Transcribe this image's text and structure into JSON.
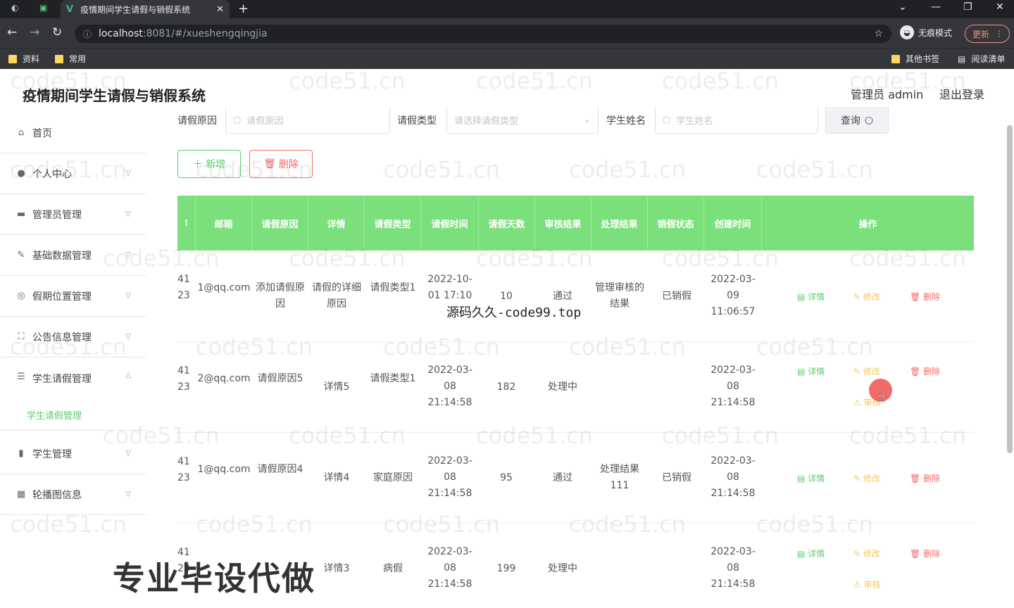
{
  "browser": {
    "tab_title": "疫情期间学生请假与销假系统",
    "tab_logo": "V",
    "url_host": "localhost",
    "url_path": ":8081/#/xueshengqingjia",
    "incognito_label": "无痕模式",
    "update_label": "更新",
    "bookmarks": [
      "资料",
      "常用"
    ],
    "bookmarks_right": [
      "其他书签",
      "阅读清单"
    ]
  },
  "app": {
    "title": "疫情期间学生请假与销假系统",
    "admin_label": "管理员 admin",
    "logout_label": "退出登录"
  },
  "sidebar": {
    "items": [
      {
        "label": "首页",
        "icon": "home-icon"
      },
      {
        "label": "个人中心",
        "icon": "user-icon"
      },
      {
        "label": "管理员管理",
        "icon": "admin-icon"
      },
      {
        "label": "基础数据管理",
        "icon": "data-icon"
      },
      {
        "label": "假期位置管理",
        "icon": "location-icon"
      },
      {
        "label": "公告信息管理",
        "icon": "notice-icon"
      },
      {
        "label": "学生请假管理",
        "icon": "list-icon"
      },
      {
        "label": "学生管理",
        "icon": "chart-icon"
      },
      {
        "label": "轮播图信息",
        "icon": "carousel-icon"
      }
    ],
    "active_sub": "学生请假管理"
  },
  "search": {
    "reason_label": "请假原因",
    "reason_placeholder": "请假原因",
    "type_label": "请假类型",
    "type_placeholder": "请选择请假类型",
    "name_label": "学生姓名",
    "name_placeholder": "学生姓名",
    "query_label": "查询"
  },
  "actions": {
    "add_label": "＋ 新增",
    "delete_label": "删除"
  },
  "table": {
    "columns": [
      "邮箱",
      "请假原因",
      "详情",
      "请假类型",
      "请假时间",
      "请假天数",
      "审核结果",
      "处理结果",
      "销假状态",
      "创建时间",
      "操作"
    ],
    "rows": [
      {
        "email": "1@qq.com",
        "reason": "添加请假原因",
        "detail": "请假的详细原因",
        "type": "请假类型1",
        "time": "2022-10-01 17:10",
        "days": "10",
        "audit": "通过",
        "result": "管理审核的结果",
        "status": "已销假",
        "created": "2022-03-09 11:06:57",
        "frag": "41 23"
      },
      {
        "email": "2@qq.com",
        "reason": "请假原因5",
        "detail": "详情5",
        "type": "请假类型1",
        "time": "2022-03-08 21:14:58",
        "days": "182",
        "audit": "处理中",
        "result": "",
        "status": "",
        "created": "2022-03-08 21:14:58",
        "frag": "41 23"
      },
      {
        "email": "1@qq.com",
        "reason": "请假原因4",
        "detail": "详情4",
        "type": "家庭原因",
        "time": "2022-03-08 21:14:58",
        "days": "95",
        "audit": "通过",
        "result": "处理结果111",
        "status": "已销假",
        "created": "2022-03-08 21:14:58",
        "frag": "41 23"
      },
      {
        "email": "",
        "reason": "",
        "detail": "详情3",
        "type": "病假",
        "time": "2022-03-08 21:14:58",
        "days": "199",
        "audit": "处理中",
        "result": "",
        "status": "",
        "created": "2022-03-08 21:14:58",
        "frag": "41 23"
      }
    ],
    "op_detail": "详情",
    "op_edit": "修改",
    "op_delete": "删除",
    "op_audit": "审核"
  },
  "overlays": {
    "promo_text": "专业毕设代做",
    "source_text": "源码久久-code99.top",
    "watermark": "code51.cn"
  }
}
